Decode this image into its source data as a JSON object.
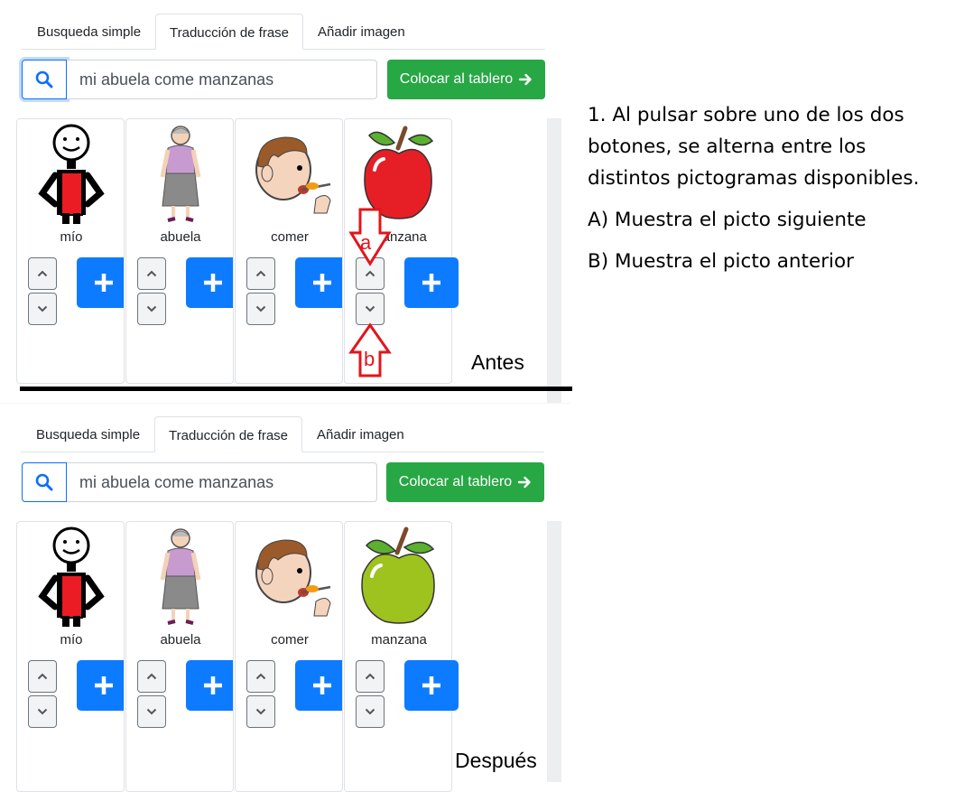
{
  "tabs": [
    "Busqueda simple",
    "Traducción de frase",
    "Añadir imagen"
  ],
  "active_tab_index": 1,
  "search": {
    "value": "mi abuela come manzanas",
    "button_icon": "search-icon"
  },
  "place_button": {
    "label": "Colocar al tablero",
    "icon": "arrow-right-icon"
  },
  "cards": [
    {
      "word": "mío",
      "image": "person-holding-red-object-pictogram"
    },
    {
      "word": "abuela",
      "image": "grandmother-pictogram"
    },
    {
      "word": "comer",
      "image": "boy-eating-pictogram"
    },
    {
      "word": "manzana",
      "image_before": "red-apple-pictogram",
      "image_after": "green-apple-pictogram"
    }
  ],
  "labels": {
    "before": "Antes",
    "after": "Después",
    "a": "a",
    "b": "b"
  },
  "notes": [
    "1. Al pulsar sobre uno de los dos botones, se alterna entre los distintos pictogramas disponibles.",
    "A) Muestra el picto siguiente",
    "B) Muestra el picto anterior"
  ],
  "colors": {
    "primary": "#0d7bff",
    "success": "#28a745",
    "annotation_red": "#e3141b"
  }
}
